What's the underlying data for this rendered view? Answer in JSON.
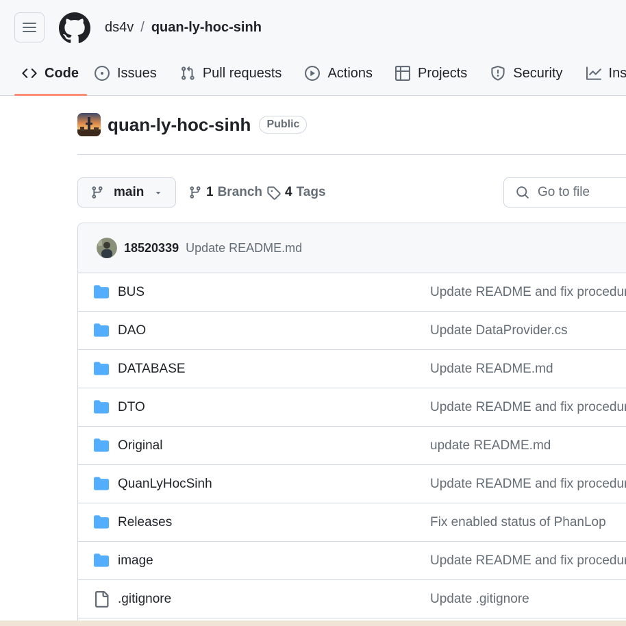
{
  "header": {
    "owner": "ds4v",
    "separator": "/",
    "repo": "quan-ly-hoc-sinh"
  },
  "tabs": [
    {
      "label": "Code",
      "icon": "code-icon"
    },
    {
      "label": "Issues",
      "icon": "issue-opened-icon"
    },
    {
      "label": "Pull requests",
      "icon": "git-pull-request-icon"
    },
    {
      "label": "Actions",
      "icon": "play-icon"
    },
    {
      "label": "Projects",
      "icon": "table-icon"
    },
    {
      "label": "Security",
      "icon": "shield-icon"
    },
    {
      "label": "Insig",
      "icon": "graph-icon"
    }
  ],
  "repo": {
    "name": "quan-ly-hoc-sinh",
    "visibility": "Public"
  },
  "branch_bar": {
    "branch": "main",
    "branch_count": "1",
    "branch_label": "Branch",
    "tag_count": "4",
    "tag_label": "Tags",
    "goto_placeholder": "Go to file"
  },
  "latest_commit": {
    "author": "18520339",
    "message": "Update README.md"
  },
  "files": [
    {
      "name": "BUS",
      "type": "folder",
      "message": "Update README and fix procedur"
    },
    {
      "name": "DAO",
      "type": "folder",
      "message": "Update DataProvider.cs"
    },
    {
      "name": "DATABASE",
      "type": "folder",
      "message": "Update README.md"
    },
    {
      "name": "DTO",
      "type": "folder",
      "message": "Update README and fix procedur"
    },
    {
      "name": "Original",
      "type": "folder",
      "message": "update README.md"
    },
    {
      "name": "QuanLyHocSinh",
      "type": "folder",
      "message": "Update README and fix procedur"
    },
    {
      "name": "Releases",
      "type": "folder",
      "message": "Fix enabled status of PhanLop"
    },
    {
      "name": "image",
      "type": "folder",
      "message": "Update README and fix procedur"
    },
    {
      "name": ".gitignore",
      "type": "file",
      "message": "Update .gitignore"
    }
  ],
  "colors": {
    "accent_underline": "#fd8c73",
    "folder": "#54aeff",
    "muted": "#656d76"
  }
}
